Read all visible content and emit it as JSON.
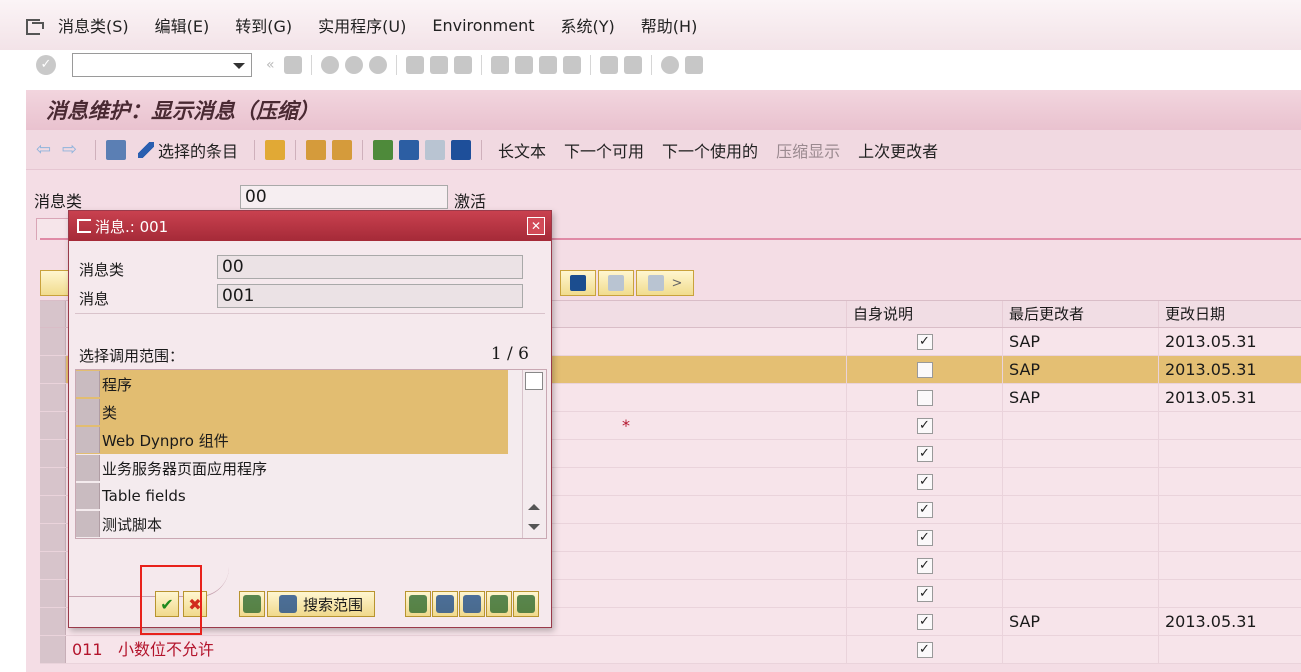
{
  "menu": [
    "消息类(S)",
    "编辑(E)",
    "转到(G)",
    "实用程序(U)",
    "Environment",
    "系统(Y)",
    "帮助(H)"
  ],
  "screen": {
    "title": "消息维护：显示消息（压缩）",
    "toolbar": {
      "selected_items": "选择的条目",
      "long_text": "长文本",
      "next_available": "下一个可用",
      "next_used": "下一个使用的",
      "compress_display": "压缩显示",
      "last_changer": "上次更改者"
    },
    "header": {
      "msg_class_label": "消息类",
      "msg_class_value": "00",
      "status": "激活"
    }
  },
  "table": {
    "columns": [
      "自身说明",
      "最后更改者",
      "更改日期"
    ],
    "rows": [
      {
        "num": "",
        "text": "",
        "self": true,
        "user": "SAP",
        "date": "2013.05.31"
      },
      {
        "num": "",
        "text": "",
        "self": false,
        "user": "SAP",
        "date": "2013.05.31",
        "selected": true
      },
      {
        "num": "",
        "text": "",
        "self": false,
        "user": "SAP",
        "date": "2013.05.31"
      },
      {
        "num": "",
        "text": "*",
        "self": true,
        "user": "",
        "date": ""
      },
      {
        "num": "",
        "text": "",
        "self": true,
        "user": "",
        "date": ""
      },
      {
        "num": "",
        "text": "",
        "self": true,
        "user": "",
        "date": ""
      },
      {
        "num": "",
        "text": "",
        "self": true,
        "user": "",
        "date": ""
      },
      {
        "num": "",
        "text": "",
        "self": true,
        "user": "",
        "date": ""
      },
      {
        "num": "",
        "text": "",
        "self": true,
        "user": "",
        "date": ""
      },
      {
        "num": "",
        "text": "",
        "self": true,
        "user": "",
        "date": ""
      },
      {
        "num": "",
        "text": "",
        "self": true,
        "user": "SAP",
        "date": "2013.05.31"
      },
      {
        "num": "011",
        "text": "小数位不允许",
        "self": true,
        "user": "",
        "date": ""
      }
    ]
  },
  "dialog": {
    "title": "消息.: 001",
    "msg_class_label": "消息类",
    "msg_class_value": "00",
    "msg_label": "消息",
    "msg_value": "001",
    "scope_label": "选择调用范围：",
    "counter": "1 / 6",
    "items": [
      {
        "label": "程序",
        "selected": true
      },
      {
        "label": "类",
        "selected": true
      },
      {
        "label": "Web Dynpro 组件",
        "selected": true
      },
      {
        "label": "业务服务器页面应用程序",
        "selected": false
      },
      {
        "label": "Table fields",
        "selected": false
      },
      {
        "label": "测试脚本",
        "selected": false
      }
    ],
    "search_scope": "搜索范围",
    "ok_icon": "checkmark-icon",
    "cancel_icon": "cancel-x-icon"
  },
  "colors": {
    "highlight": "#e4bf73",
    "dialog_title": "#b3303e",
    "annotation": "#e8211b"
  }
}
